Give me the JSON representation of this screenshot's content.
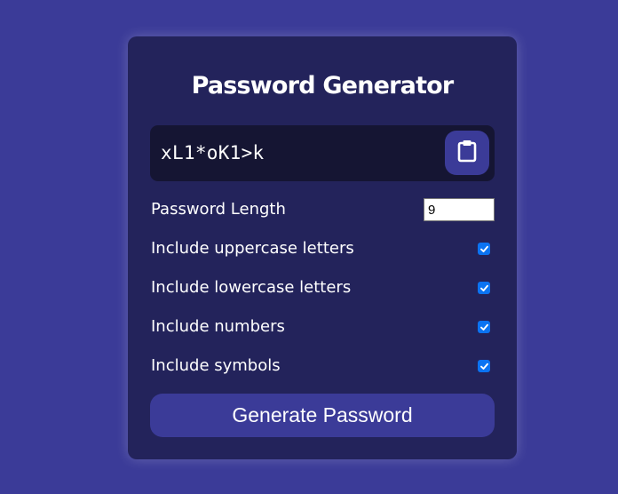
{
  "app": {
    "title": "Password Generator"
  },
  "result": {
    "password": "xL1*oK1>k",
    "copy_icon": "clipboard-icon"
  },
  "settings": {
    "length": {
      "label": "Password Length",
      "value": "9"
    },
    "uppercase": {
      "label": "Include uppercase letters",
      "checked": true
    },
    "lowercase": {
      "label": "Include lowercase letters",
      "checked": true
    },
    "numbers": {
      "label": "Include numbers",
      "checked": true
    },
    "symbols": {
      "label": "Include symbols",
      "checked": true
    }
  },
  "generate": {
    "label": "Generate Password"
  },
  "colors": {
    "page_background": "#3b3b98",
    "card_background": "#23235b",
    "result_background": "#151533",
    "accent": "#3b3b98",
    "checkbox": "#0b73f2"
  }
}
